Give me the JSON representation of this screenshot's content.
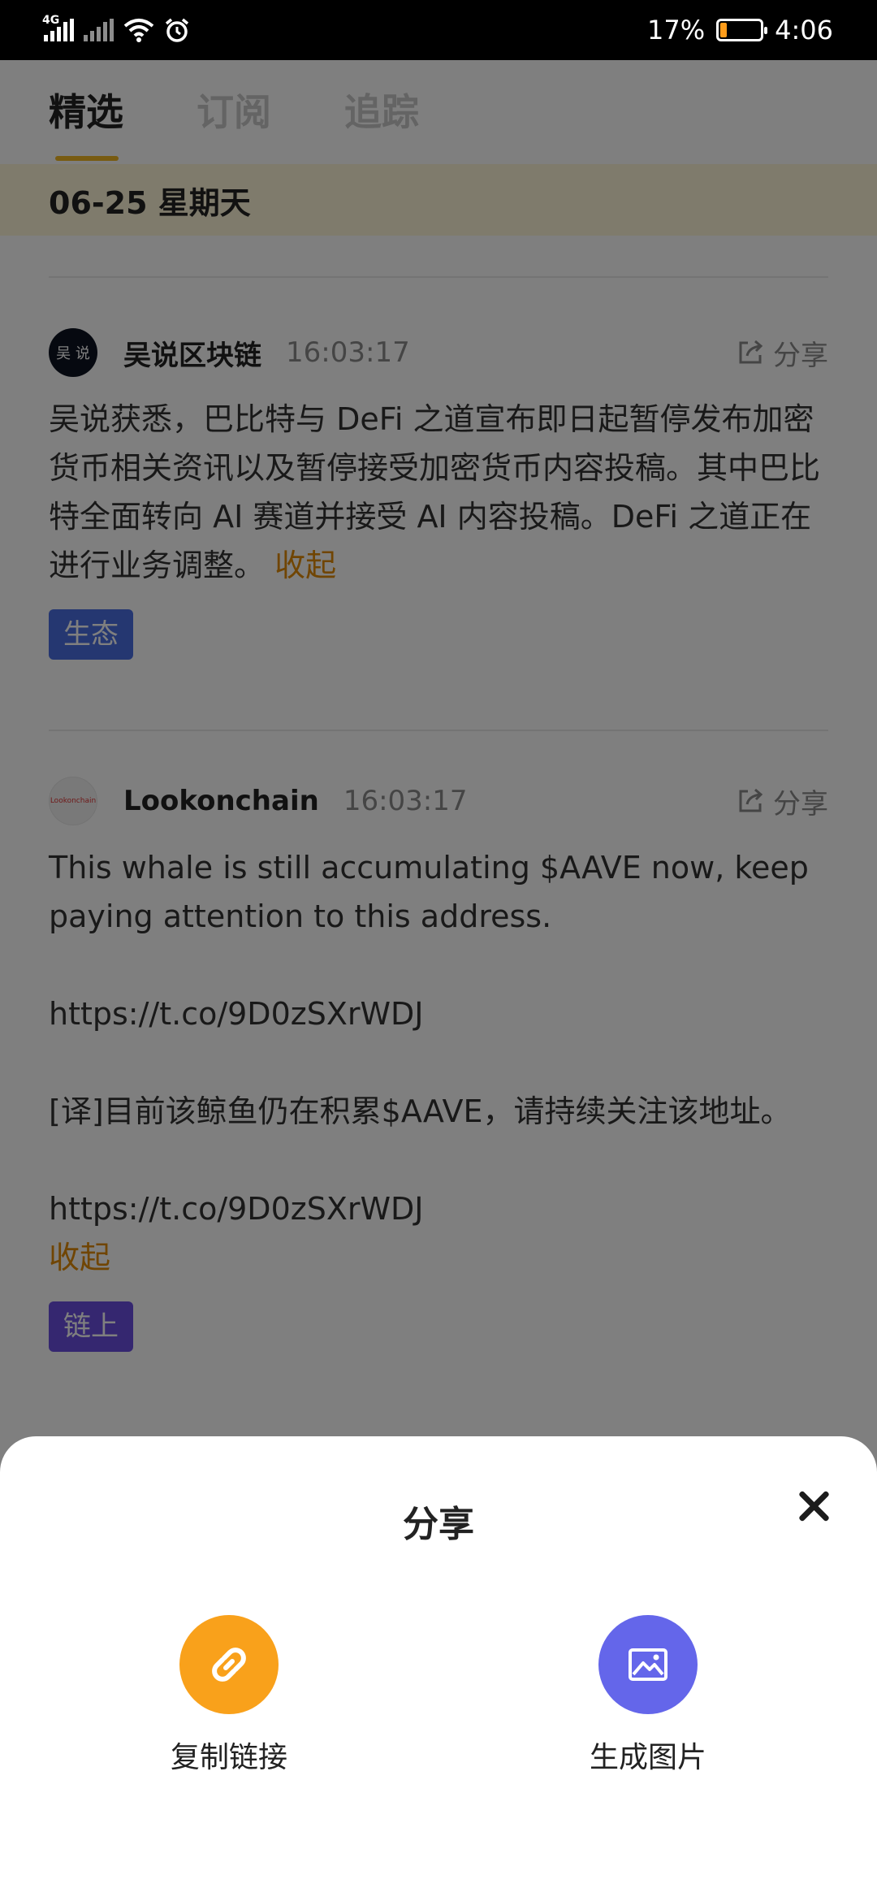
{
  "status_bar": {
    "network": "4G",
    "battery_percent": "17%",
    "battery_level": 0.17,
    "time": "4:06"
  },
  "tabs": [
    {
      "label": "精选",
      "active": true
    },
    {
      "label": "订阅",
      "active": false
    },
    {
      "label": "追踪",
      "active": false
    }
  ],
  "date_header": "06-25 星期天",
  "posts": [
    {
      "avatar_text": "吴 说",
      "author": "吴说区块链",
      "time": "16:03:17",
      "share_label": "分享",
      "body": "吴说获悉，巴比特与 DeFi 之道宣布即日起暂停发布加密货币相关资讯以及暂停接受加密货币内容投稿。其中巴比特全面转向 AI 赛道并接受 AI 内容投稿。DeFi 之道正在进行业务调整。",
      "collapse_label": "收起",
      "tag": "生态",
      "tag_color": "#4a6fe3"
    },
    {
      "avatar_text": "Lookonchain",
      "author": "Lookonchain",
      "time": "16:03:17",
      "share_label": "分享",
      "body": "This whale is still accumulating $AAVE now, keep paying attention to this address.\n\nhttps://t.co/9D0zSXrWDJ\n\n[译]目前该鲸鱼仍在积累$AAVE，请持续关注该地址。\n\nhttps://t.co/9D0zSXrWDJ",
      "collapse_label": "收起",
      "tag": "链上",
      "tag_color": "#6a4fe0"
    }
  ],
  "share_sheet": {
    "title": "分享",
    "options": [
      {
        "label": "复制链接",
        "icon": "link-icon",
        "color": "#f9a11b"
      },
      {
        "label": "生成图片",
        "icon": "image-icon",
        "color": "#6466ea"
      }
    ]
  }
}
